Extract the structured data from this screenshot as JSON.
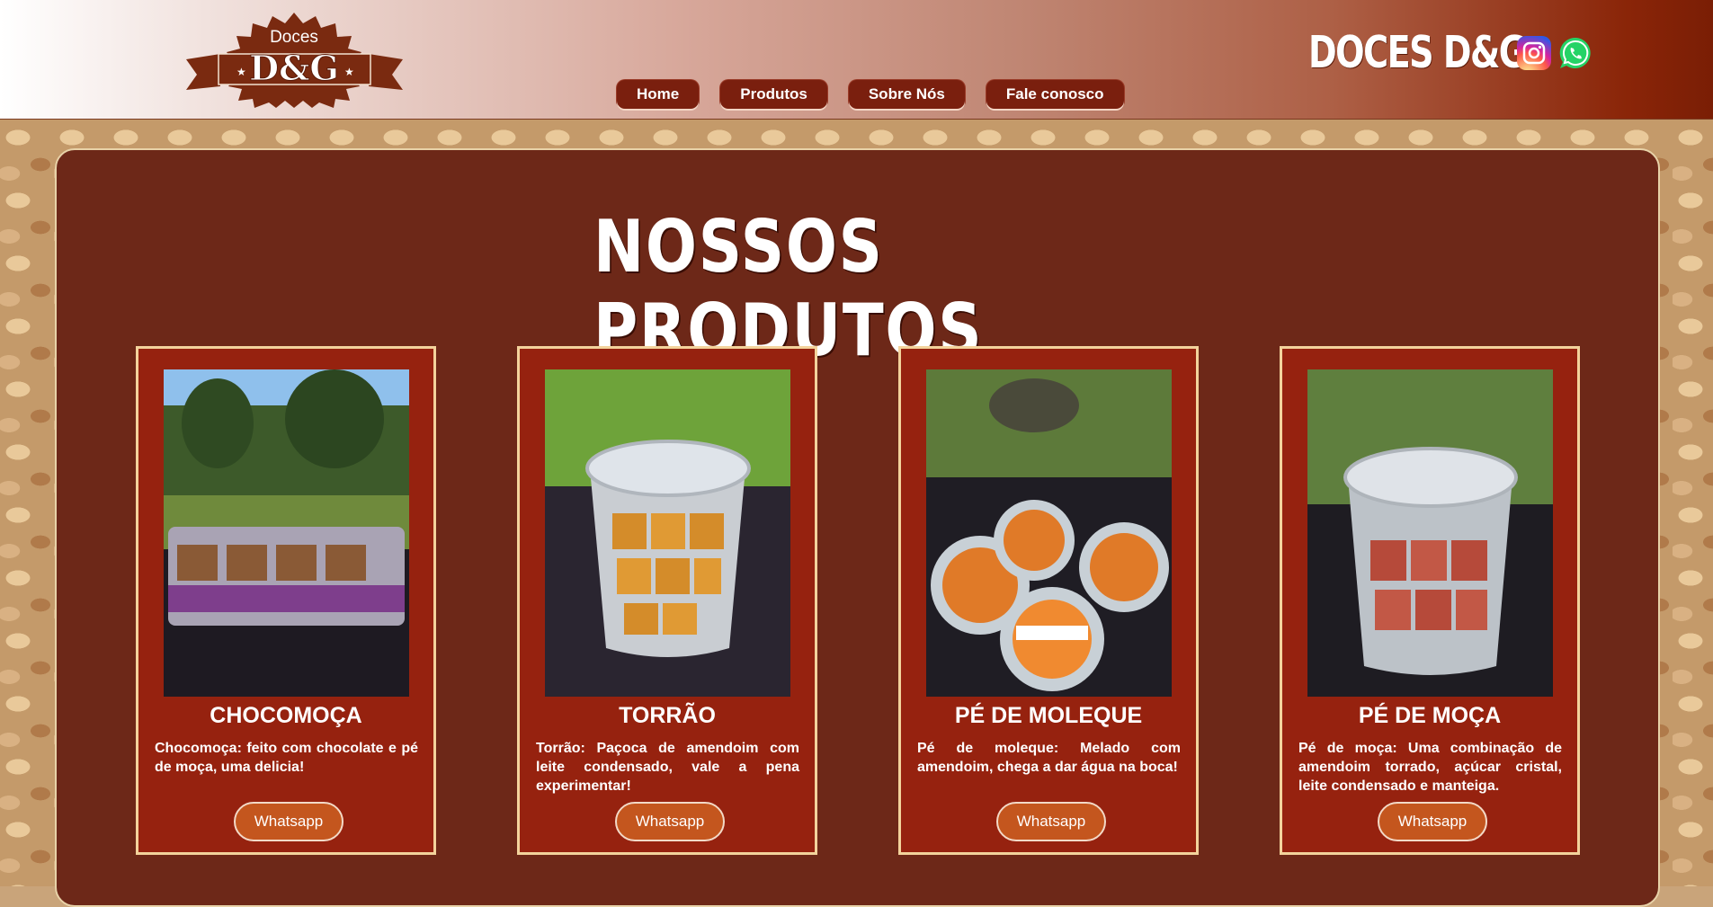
{
  "header": {
    "logo": {
      "top_text": "Doces",
      "main_text": "D&G"
    },
    "brand": "DOCES D&G",
    "nav": [
      "Home",
      "Produtos",
      "Sobre Nós",
      "Fale conosco"
    ],
    "social": [
      "instagram-icon",
      "whatsapp-icon"
    ]
  },
  "section": {
    "title": "NOSSOS PRODUTOS"
  },
  "products": [
    {
      "name": "CHOCOMOÇA",
      "description": "Chocomoça: feito com chocolate e pé de moça, uma delicia!",
      "button": "Whatsapp"
    },
    {
      "name": "TORRÃO",
      "description": "Torrão: Paçoca de amendoim com leite condensado, vale a pena experimentar!",
      "button": "Whatsapp"
    },
    {
      "name": "PÉ DE MOLEQUE",
      "description": "Pé de moleque: Melado com amendoim, chega a dar água na boca!",
      "button": "Whatsapp"
    },
    {
      "name": "PÉ DE MOÇA",
      "description": "Pé de moça: Uma combinação de amendoim torrado, açúcar cristal, leite condensado e manteiga.",
      "button": "Whatsapp"
    }
  ],
  "colors": {
    "header_end": "#7a1e05",
    "panel": "#6d2818",
    "card": "#96220f",
    "border": "#f3d39c",
    "button": "#c4561e"
  }
}
